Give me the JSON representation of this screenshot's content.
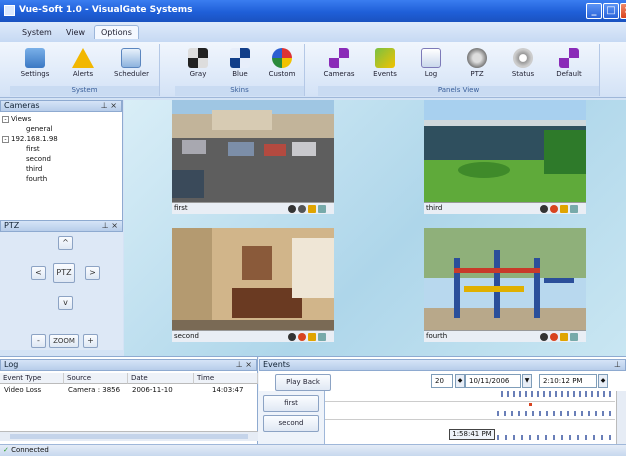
{
  "app": {
    "title": "Vue-Soft 1.0 - VisualGate Systems"
  },
  "menu": {
    "items": [
      "System",
      "View",
      "Options"
    ],
    "active_index": 2
  },
  "ribbon": {
    "groups": [
      {
        "label": "System",
        "buttons": [
          {
            "label": "Settings",
            "icon": "settings-icon"
          },
          {
            "label": "Alerts",
            "icon": "alert-icon"
          },
          {
            "label": "Scheduler",
            "icon": "scheduler-icon"
          }
        ]
      },
      {
        "label": "Skins",
        "buttons": [
          {
            "label": "Gray",
            "icon": "gray-skin-icon"
          },
          {
            "label": "Blue",
            "icon": "blue-skin-icon"
          },
          {
            "label": "Custom",
            "icon": "custom-skin-icon"
          }
        ]
      },
      {
        "label": "Panels View",
        "buttons": [
          {
            "label": "Cameras",
            "icon": "cameras-panel-icon"
          },
          {
            "label": "Events",
            "icon": "events-panel-icon"
          },
          {
            "label": "Log",
            "icon": "log-panel-icon"
          },
          {
            "label": "PTZ",
            "icon": "ptz-panel-icon"
          },
          {
            "label": "Status",
            "icon": "status-panel-icon"
          },
          {
            "label": "Default",
            "icon": "default-panel-icon"
          }
        ]
      }
    ]
  },
  "cameras_panel": {
    "title": "Cameras",
    "tree": {
      "root": "Views",
      "views": [
        "general"
      ],
      "server": "192.168.1.98",
      "cameras": [
        "first",
        "second",
        "third",
        "fourth"
      ]
    }
  },
  "ptz_panel": {
    "title": "PTZ",
    "center": "PTZ",
    "zoom": "ZOOM",
    "up": "^",
    "down": "v",
    "left": "<",
    "right": ">",
    "minus": "-",
    "plus": "+"
  },
  "views": [
    {
      "name": "first"
    },
    {
      "name": "second"
    },
    {
      "name": "third"
    },
    {
      "name": "fourth"
    }
  ],
  "log_panel": {
    "title": "Log",
    "columns": [
      "Event Type",
      "Source",
      "Date",
      "Time"
    ],
    "rows": [
      [
        "Video Loss",
        "Camera : 3856",
        "2006-11-10",
        "14:03:47"
      ]
    ]
  },
  "events_panel": {
    "title": "Events",
    "play_back": "Play Back",
    "count": "20",
    "date": "10/11/2006",
    "time": "2:10:12 PM",
    "cameras": [
      "first",
      "second"
    ],
    "timeline_time": "1:58:41 PM"
  },
  "status": {
    "text": "Connected"
  },
  "colors": {
    "titlebar": "#1f5fd8",
    "ribbon": "#d3e2f6",
    "accent": "#d8431f"
  }
}
